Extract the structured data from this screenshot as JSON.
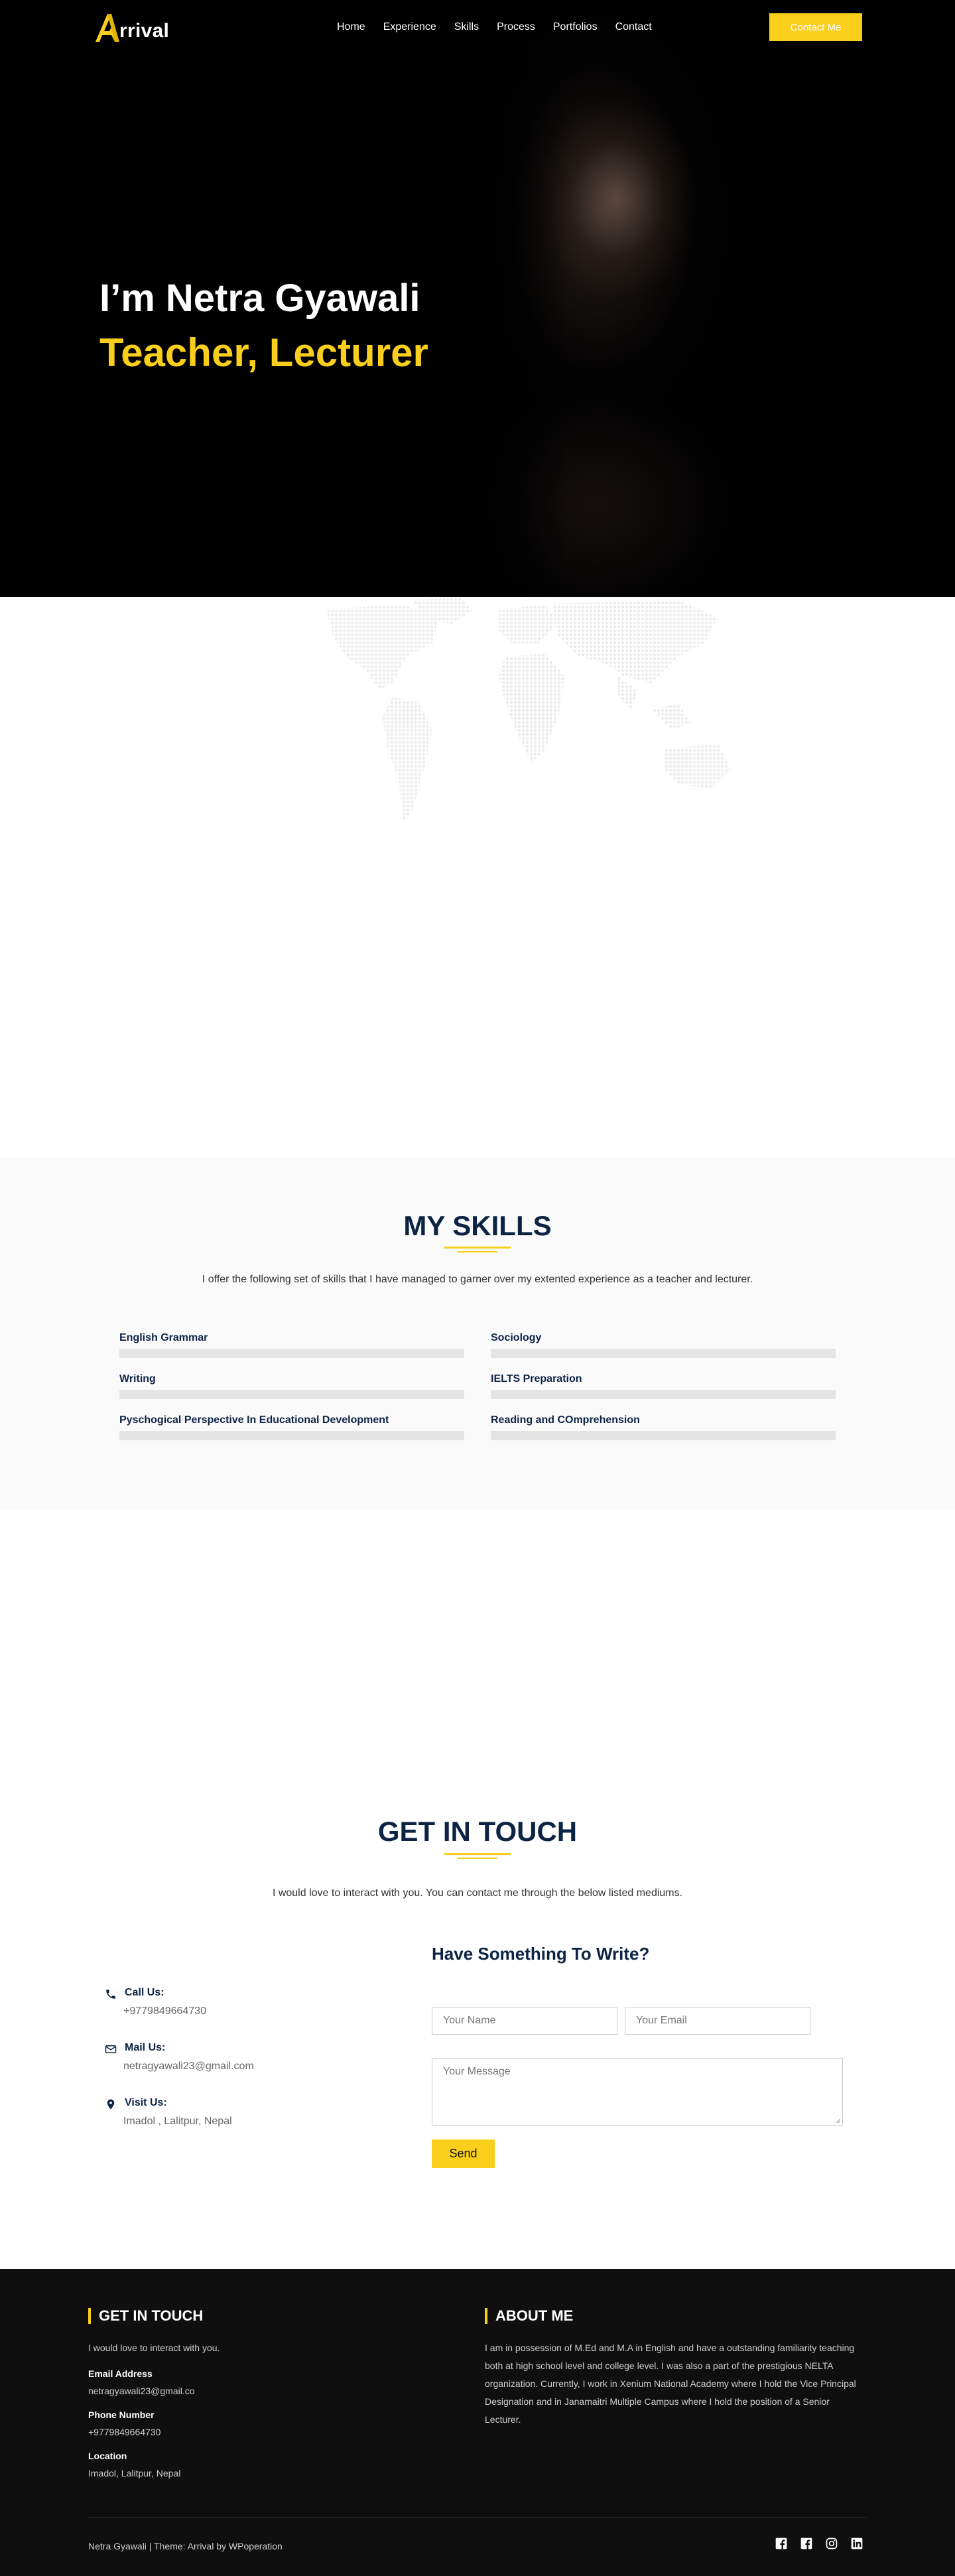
{
  "brand": {
    "logo_text": "rrival",
    "accent": "#f9cf1b",
    "navy": "#0c2344"
  },
  "nav": {
    "items": [
      {
        "label": "Home"
      },
      {
        "label": "Experience"
      },
      {
        "label": "Skills"
      },
      {
        "label": "Process"
      },
      {
        "label": "Portfolios"
      },
      {
        "label": "Contact"
      }
    ],
    "cta_label": "Contact Me"
  },
  "hero": {
    "title": "I’m Netra Gyawali",
    "subtitle": "Teacher, Lecturer"
  },
  "skills": {
    "title": "MY SKILLS",
    "description": "I offer the following set of skills that I have managed to garner over my extented experience as a teacher and lecturer.",
    "items": [
      {
        "name": "English Grammar",
        "level": null
      },
      {
        "name": "Sociology",
        "level": null
      },
      {
        "name": "Writing",
        "level": null
      },
      {
        "name": "IELTS Preparation",
        "level": null
      },
      {
        "name": "Pyschogical Perspective In Educational Development",
        "level": null
      },
      {
        "name": "Reading and COmprehension",
        "level": null
      }
    ]
  },
  "touch": {
    "title": "GET IN TOUCH",
    "description": "I would love to interact with you. You can contact me through the below listed mediums.",
    "info": [
      {
        "label": "Call Us:",
        "value": "+9779849664730",
        "icon": "phone-icon"
      },
      {
        "label": "Mail Us:",
        "value": "netragyawali23@gmail.com",
        "icon": "mail-icon"
      },
      {
        "label": "Visit Us:",
        "value": "Imadol , Lalitpur, Nepal",
        "icon": "location-pin-icon"
      }
    ],
    "form": {
      "title": "Have Something To Write?",
      "name_placeholder": "Your Name",
      "email_placeholder": "Your Email",
      "message_placeholder": "Your Message",
      "send_label": "Send"
    }
  },
  "footer": {
    "left_heading": "GET IN TOUCH",
    "left_intro": "I would love to interact with you.",
    "email_label": "Email Address",
    "email_value": "netragyawali23@gmail.co",
    "phone_label": "Phone Number",
    "phone_value": "+9779849664730",
    "location_label": "Location",
    "location_value": "Imadol, Lalitpur, Nepal",
    "right_heading": "ABOUT ME",
    "about_text": "I am in possession of M.Ed and M.A in English and have a outstanding familiarity teaching both at high school level and college level. I was also a part of the prestigious NELTA organization. Currently, I work in Xenium National Academy where I hold the Vice Principal Designation and in Janamaitri Multiple Campus where I hold the position of a Senior Lecturer.",
    "credit": "Netra Gyawali | Theme: Arrival by WPoperation",
    "social": [
      "facebook-icon",
      "facebook-square-icon",
      "instagram-icon",
      "linkedin-icon"
    ]
  }
}
